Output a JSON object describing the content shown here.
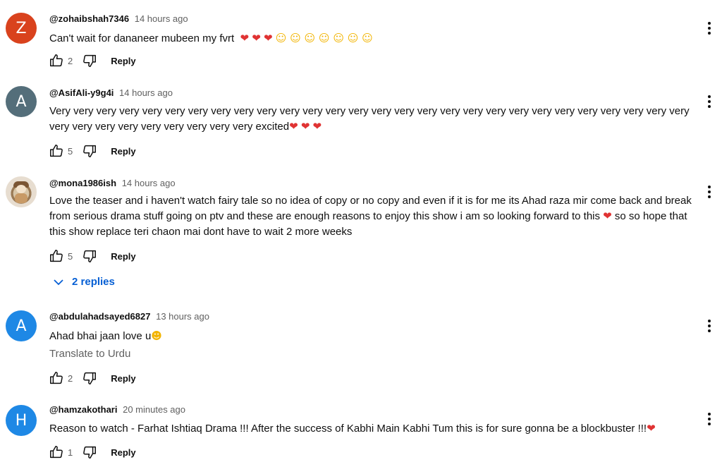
{
  "colors": {
    "link": "#065fd4",
    "muted": "#606060",
    "heart": "#e03333",
    "avatar_z": "#d9421d",
    "avatar_a_dark": "#546e7a",
    "avatar_a_blue": "#1e88e5",
    "avatar_h_blue": "#1e88e5"
  },
  "comments": [
    {
      "avatar_letter": "Z",
      "handle": "@zohaibshah7346",
      "time": "14 hours ago",
      "text": "Can't wait for dananeer mubeen my fvrt",
      "emoji": [
        "heart",
        "heart",
        "heart",
        "smile",
        "smile",
        "smile",
        "smile",
        "smile",
        "smile",
        "smile"
      ],
      "likes": "2",
      "reply_label": "Reply"
    },
    {
      "avatar_letter": "A",
      "handle": "@AsifAli-y9g4i",
      "time": "14 hours ago",
      "text": "Very very very very very very very very very very very very very very very very very very very very very very very very very very very very very very very very very very very very very excited",
      "emoji": [
        "heart",
        "heart",
        "heart"
      ],
      "likes": "5",
      "reply_label": "Reply"
    },
    {
      "avatar_letter": "",
      "handle": "@mona1986ish",
      "time": "14 hours ago",
      "text": "Love the teaser and i haven't watch fairy tale so no idea of copy or no copy and even if it is for me its Ahad raza mir come back and break from serious drama stuff going on ptv and these are enough reasons to enjoy this show i am so looking forward to this",
      "text_after": "so so hope that this show replace teri chaon mai dont have to wait 2 more weeks",
      "likes": "5",
      "reply_label": "Reply",
      "replies_label": "2 replies"
    },
    {
      "avatar_letter": "A",
      "handle": "@abdulahadsayed6827",
      "time": "13 hours ago",
      "text": "Ahad bhai jaan love u",
      "translate_label": "Translate to Urdu",
      "likes": "2",
      "reply_label": "Reply"
    },
    {
      "avatar_letter": "H",
      "handle": "@hamzakothari",
      "time": "20 minutes ago",
      "text": "Reason to watch - Farhat Ishtiaq Drama !!! After the success of Kabhi Main Kabhi Tum this is for sure gonna be a blockbuster !!!",
      "likes": "1",
      "reply_label": "Reply"
    }
  ],
  "icons": {
    "like": "thumb-up-icon",
    "dislike": "thumb-down-icon",
    "more": "more-vert-icon",
    "expand": "chevron-down-icon"
  }
}
